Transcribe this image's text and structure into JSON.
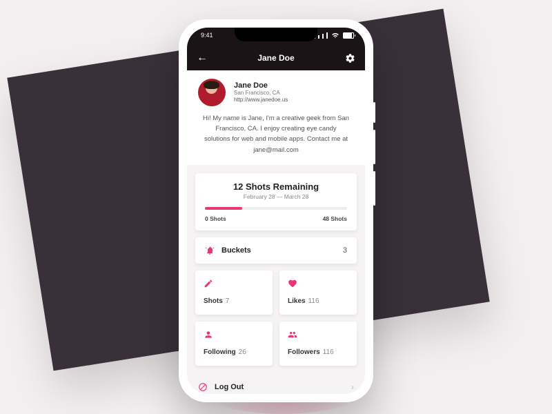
{
  "status": {
    "time": "9:41"
  },
  "header": {
    "title": "Jane Doe"
  },
  "profile": {
    "name": "Jane Doe",
    "location": "San Francisco, CA",
    "url": "http://www.janedoe.us",
    "bio": "Hi! My name is Jane, I'm a creative geek from San Francisco, CA. I enjoy creating eye candy solutions for web and mobile apps. Contact me at jane@mail.com"
  },
  "shots_card": {
    "headline": "12 Shots Remaining",
    "period": "February 28 — March 28",
    "min_label": "0 Shots",
    "max_label": "48 Shots",
    "progress_pct": 26
  },
  "buckets": {
    "label": "Buckets",
    "count": "3"
  },
  "stats": {
    "shots": {
      "label": "Shots",
      "value": "7"
    },
    "likes": {
      "label": "Likes",
      "value": "116"
    },
    "following": {
      "label": "Following",
      "value": "26"
    },
    "followers": {
      "label": "Followers",
      "value": "116"
    }
  },
  "logout": {
    "label": "Log Out"
  },
  "colors": {
    "accent": "#e73672"
  }
}
